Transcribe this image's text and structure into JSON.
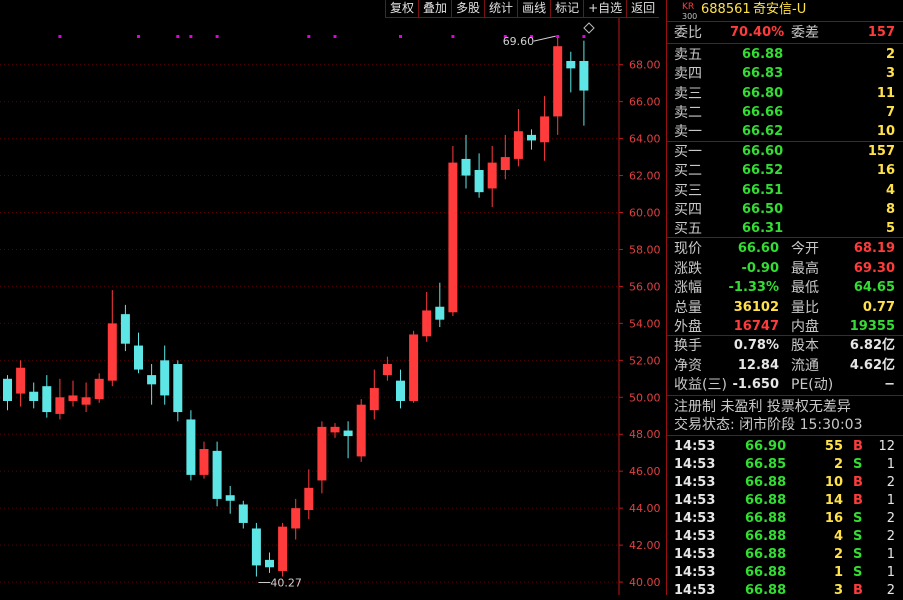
{
  "toolbar": [
    "复权",
    "叠加",
    "多股",
    "统计",
    "画线",
    "标记",
    "+自选",
    "返回"
  ],
  "stock": {
    "badge_top": "KR",
    "badge_bottom": "300",
    "code": "688561",
    "name": "奇安信-U"
  },
  "weibi": {
    "label": "委比",
    "value": "70.40%",
    "diff_label": "委差",
    "diff_value": "157"
  },
  "sell": [
    {
      "label": "卖五",
      "price": "66.88",
      "vol": "2"
    },
    {
      "label": "卖四",
      "price": "66.83",
      "vol": "3"
    },
    {
      "label": "卖三",
      "price": "66.80",
      "vol": "11"
    },
    {
      "label": "卖二",
      "price": "66.66",
      "vol": "7"
    },
    {
      "label": "卖一",
      "price": "66.62",
      "vol": "10"
    }
  ],
  "buy": [
    {
      "label": "买一",
      "price": "66.60",
      "vol": "157"
    },
    {
      "label": "买二",
      "price": "66.52",
      "vol": "16"
    },
    {
      "label": "买三",
      "price": "66.51",
      "vol": "4"
    },
    {
      "label": "买四",
      "price": "66.50",
      "vol": "8"
    },
    {
      "label": "买五",
      "price": "66.31",
      "vol": "5"
    }
  ],
  "quote": [
    {
      "l1": "现价",
      "v1": "66.60",
      "l2": "今开",
      "v2": "68.19"
    },
    {
      "l1": "涨跌",
      "v1": "-0.90",
      "l2": "最高",
      "v2": "69.30"
    },
    {
      "l1": "涨幅",
      "v1": "-1.33%",
      "l2": "最低",
      "v2": "64.65"
    },
    {
      "l1": "总量",
      "v1": "36102",
      "l2": "量比",
      "v2": "0.77"
    },
    {
      "l1": "外盘",
      "v1": "16747",
      "l2": "内盘",
      "v2": "19355"
    }
  ],
  "fund": [
    {
      "l1": "换手",
      "v1": "0.78%",
      "l2": "股本",
      "v2": "6.82亿"
    },
    {
      "l1": "净资",
      "v1": "12.84",
      "l2": "流通",
      "v2": "4.62亿"
    },
    {
      "l1": "收益(三)",
      "v1": "-1.650",
      "l2": "PE(动)",
      "v2": "−"
    }
  ],
  "info_line": "注册制 未盈利 投票权无差异",
  "trade_status": "交易状态: 闭市阶段 15:30:03",
  "ticks": [
    {
      "t": "14:53",
      "p": "66.90",
      "v": "55",
      "d": "B",
      "n": "12"
    },
    {
      "t": "14:53",
      "p": "66.85",
      "v": "2",
      "d": "S",
      "n": "1"
    },
    {
      "t": "14:53",
      "p": "66.88",
      "v": "10",
      "d": "B",
      "n": "2"
    },
    {
      "t": "14:53",
      "p": "66.88",
      "v": "14",
      "d": "B",
      "n": "1"
    },
    {
      "t": "14:53",
      "p": "66.88",
      "v": "16",
      "d": "S",
      "n": "2"
    },
    {
      "t": "14:53",
      "p": "66.88",
      "v": "4",
      "d": "S",
      "n": "2"
    },
    {
      "t": "14:53",
      "p": "66.88",
      "v": "2",
      "d": "S",
      "n": "1"
    },
    {
      "t": "14:53",
      "p": "66.88",
      "v": "1",
      "d": "S",
      "n": "1"
    },
    {
      "t": "14:53",
      "p": "66.88",
      "v": "3",
      "d": "B",
      "n": "2"
    }
  ],
  "colors": {
    "up": "#ff3b3b",
    "down": "#5ee6e6",
    "grid": "#5a0000",
    "axis": "#e04040",
    "marker": "#e000e0"
  },
  "chart_data": {
    "type": "candlestick",
    "y_ticks": [
      "68.00",
      "66.00",
      "64.00",
      "62.00",
      "60.00",
      "58.00",
      "56.00",
      "54.00",
      "52.00",
      "50.00",
      "48.00",
      "46.00",
      "44.00",
      "42.00",
      "40.00"
    ],
    "ylim": [
      39.3,
      71.5
    ],
    "high_label": "69.60",
    "low_label": "40.27",
    "candles": [
      {
        "o": 51.0,
        "c": 49.8,
        "h": 51.2,
        "l": 49.3
      },
      {
        "o": 50.2,
        "c": 51.6,
        "h": 52.0,
        "l": 49.5
      },
      {
        "o": 50.3,
        "c": 49.8,
        "h": 50.8,
        "l": 49.4
      },
      {
        "o": 50.6,
        "c": 49.2,
        "h": 51.2,
        "l": 48.9
      },
      {
        "o": 49.1,
        "c": 50.0,
        "h": 51.0,
        "l": 48.8
      },
      {
        "o": 49.8,
        "c": 50.1,
        "h": 50.9,
        "l": 49.5
      },
      {
        "o": 49.6,
        "c": 50.0,
        "h": 50.8,
        "l": 49.2
      },
      {
        "o": 49.9,
        "c": 51.0,
        "h": 51.3,
        "l": 49.7
      },
      {
        "o": 50.9,
        "c": 54.0,
        "h": 55.8,
        "l": 50.6
      },
      {
        "o": 54.5,
        "c": 52.9,
        "h": 55.0,
        "l": 52.5
      },
      {
        "o": 52.8,
        "c": 51.5,
        "h": 53.5,
        "l": 51.3
      },
      {
        "o": 51.2,
        "c": 50.7,
        "h": 51.8,
        "l": 49.6
      },
      {
        "o": 52.0,
        "c": 50.1,
        "h": 52.8,
        "l": 49.6
      },
      {
        "o": 51.8,
        "c": 49.2,
        "h": 52.0,
        "l": 48.7
      },
      {
        "o": 48.8,
        "c": 45.8,
        "h": 49.3,
        "l": 45.5
      },
      {
        "o": 45.8,
        "c": 47.2,
        "h": 47.6,
        "l": 45.6
      },
      {
        "o": 47.1,
        "c": 44.5,
        "h": 47.6,
        "l": 44.1
      },
      {
        "o": 44.7,
        "c": 44.4,
        "h": 45.2,
        "l": 43.7
      },
      {
        "o": 44.2,
        "c": 43.2,
        "h": 44.4,
        "l": 42.9
      },
      {
        "o": 42.9,
        "c": 40.9,
        "h": 43.2,
        "l": 40.3
      },
      {
        "o": 41.2,
        "c": 40.8,
        "h": 41.6,
        "l": 40.5
      },
      {
        "o": 40.6,
        "c": 43.0,
        "h": 43.2,
        "l": 40.3
      },
      {
        "o": 42.9,
        "c": 44.0,
        "h": 44.5,
        "l": 42.3
      },
      {
        "o": 43.9,
        "c": 45.1,
        "h": 46.1,
        "l": 43.4
      },
      {
        "o": 45.5,
        "c": 48.4,
        "h": 48.7,
        "l": 44.8
      },
      {
        "o": 48.1,
        "c": 48.4,
        "h": 48.6,
        "l": 47.8
      },
      {
        "o": 48.2,
        "c": 47.9,
        "h": 48.7,
        "l": 46.7
      },
      {
        "o": 46.8,
        "c": 49.6,
        "h": 49.9,
        "l": 46.5
      },
      {
        "o": 49.3,
        "c": 50.5,
        "h": 51.5,
        "l": 48.8
      },
      {
        "o": 51.2,
        "c": 51.8,
        "h": 52.2,
        "l": 50.9
      },
      {
        "o": 50.9,
        "c": 49.8,
        "h": 51.5,
        "l": 49.4
      },
      {
        "o": 49.8,
        "c": 53.4,
        "h": 53.6,
        "l": 49.7
      },
      {
        "o": 53.3,
        "c": 54.7,
        "h": 55.7,
        "l": 53.0
      },
      {
        "o": 54.9,
        "c": 54.2,
        "h": 56.2,
        "l": 53.8
      },
      {
        "o": 54.6,
        "c": 62.7,
        "h": 63.6,
        "l": 54.4
      },
      {
        "o": 62.9,
        "c": 62.0,
        "h": 64.2,
        "l": 61.3
      },
      {
        "o": 62.3,
        "c": 61.1,
        "h": 63.2,
        "l": 60.8
      },
      {
        "o": 61.3,
        "c": 62.7,
        "h": 63.6,
        "l": 60.3
      },
      {
        "o": 62.3,
        "c": 63.0,
        "h": 64.2,
        "l": 61.8
      },
      {
        "o": 62.9,
        "c": 64.4,
        "h": 65.6,
        "l": 62.5
      },
      {
        "o": 64.2,
        "c": 63.9,
        "h": 64.5,
        "l": 63.4
      },
      {
        "o": 63.8,
        "c": 65.2,
        "h": 66.3,
        "l": 62.8
      },
      {
        "o": 65.2,
        "c": 69.0,
        "h": 69.6,
        "l": 64.2
      },
      {
        "o": 68.2,
        "c": 67.8,
        "h": 68.7,
        "l": 66.5
      },
      {
        "o": 68.2,
        "c": 66.6,
        "h": 69.3,
        "l": 64.7
      }
    ],
    "marker_candles": [
      4,
      10,
      13,
      14,
      16,
      23,
      25,
      30,
      34,
      38,
      40,
      42,
      44
    ]
  }
}
